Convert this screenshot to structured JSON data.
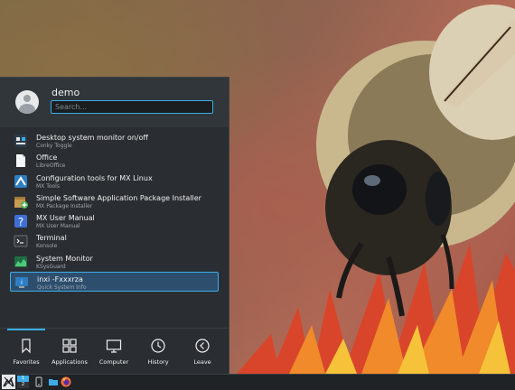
{
  "colors": {
    "menu_bg": "#2a2e32",
    "header_bg": "#31363b",
    "accent": "#3daee9",
    "selection_bg": "#2e4e6e",
    "taskbar_bg": "#202326"
  },
  "menu": {
    "user": {
      "name": "demo",
      "avatar_icon": "user-avatar-icon"
    },
    "search": {
      "placeholder": "Search..."
    },
    "apps": [
      {
        "title": "Desktop system monitor on/off",
        "subtitle": "Conky Toggle",
        "icon": "conky-icon"
      },
      {
        "title": "Office",
        "subtitle": "LibreOffice",
        "icon": "office-document-icon"
      },
      {
        "title": "Configuration tools for MX Linux",
        "subtitle": "MX Tools",
        "icon": "mx-tools-icon"
      },
      {
        "title": "Simple Software Application Package Installer",
        "subtitle": "MX Package Installer",
        "icon": "package-installer-icon"
      },
      {
        "title": "MX User Manual",
        "subtitle": "MX User Manual",
        "icon": "help-icon"
      },
      {
        "title": "Terminal",
        "subtitle": "Konsole",
        "icon": "terminal-icon"
      },
      {
        "title": "System Monitor",
        "subtitle": "KSysGuard",
        "icon": "system-monitor-icon"
      },
      {
        "title": "inxi -Fxxxrza",
        "subtitle": "Quick System Info",
        "icon": "system-info-icon",
        "selected": true
      }
    ],
    "nav": [
      {
        "label": "Favorites",
        "icon": "bookmark-icon",
        "active": true
      },
      {
        "label": "Applications",
        "icon": "applications-grid-icon"
      },
      {
        "label": "Computer",
        "icon": "computer-icon"
      },
      {
        "label": "History",
        "icon": "history-clock-icon"
      },
      {
        "label": "Leave",
        "icon": "leave-icon"
      }
    ]
  },
  "taskbar": {
    "launcher_icon": "mx-logo-icon",
    "pager": {
      "desktop_1": "1",
      "desktop_2": "2"
    },
    "tray_icons": [
      "kde-connect-icon",
      "file-manager-icon",
      "firefox-icon"
    ]
  }
}
